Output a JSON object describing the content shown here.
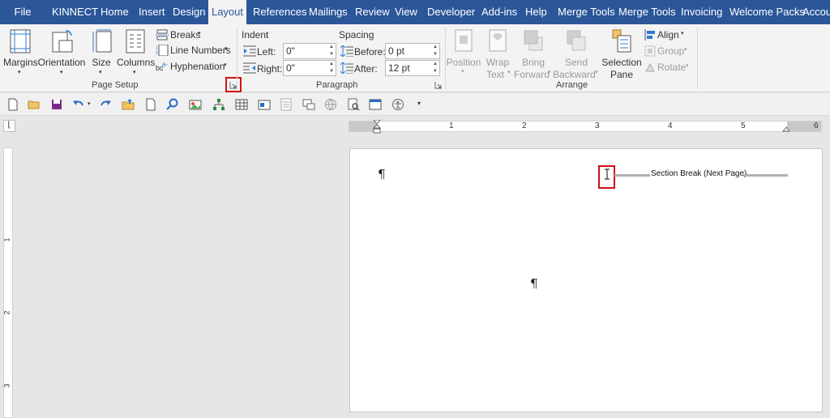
{
  "menu": {
    "tabs": [
      "File",
      "KINNECT",
      "Home",
      "Insert",
      "Design",
      "Layout",
      "References",
      "Mailings",
      "Review",
      "View",
      "Developer",
      "Add-ins",
      "Help",
      "Merge Tools",
      "Merge Tools",
      "Invoicing",
      "Welcome Packs",
      "Accou"
    ],
    "active": "Layout"
  },
  "page_setup": {
    "margins": "Margins",
    "orientation": "Orientation",
    "size": "Size",
    "columns": "Columns",
    "breaks": "Breaks",
    "line_numbers": "Line Numbers",
    "hyphenation": "Hyphenation",
    "group_label": "Page Setup"
  },
  "paragraph": {
    "indent_label": "Indent",
    "spacing_label": "Spacing",
    "left_label": "Left:",
    "left_value": "0\"",
    "right_label": "Right:",
    "right_value": "0\"",
    "before_label": "Before:",
    "before_value": "0 pt",
    "after_label": "After:",
    "after_value": "12 pt",
    "group_label": "Paragraph"
  },
  "arrange": {
    "position": "Position",
    "wrap1": "Wrap",
    "wrap2": "Text",
    "bring1": "Bring",
    "bring2": "Forward",
    "send1": "Send",
    "send2": "Backward",
    "selection1": "Selection",
    "selection2": "Pane",
    "align": "Align",
    "group": "Group",
    "rotate": "Rotate",
    "group_label": "Arrange"
  },
  "ruler": {
    "h_numbers": [
      "1",
      "2",
      "3",
      "4",
      "5",
      "6"
    ],
    "v_numbers": [
      "1",
      "2",
      "3"
    ]
  },
  "document": {
    "section_break": "Section Break (Next Page)",
    "pilcrow": "¶"
  },
  "colors": {
    "accent": "#2b579a",
    "highlight": "#d01010"
  }
}
